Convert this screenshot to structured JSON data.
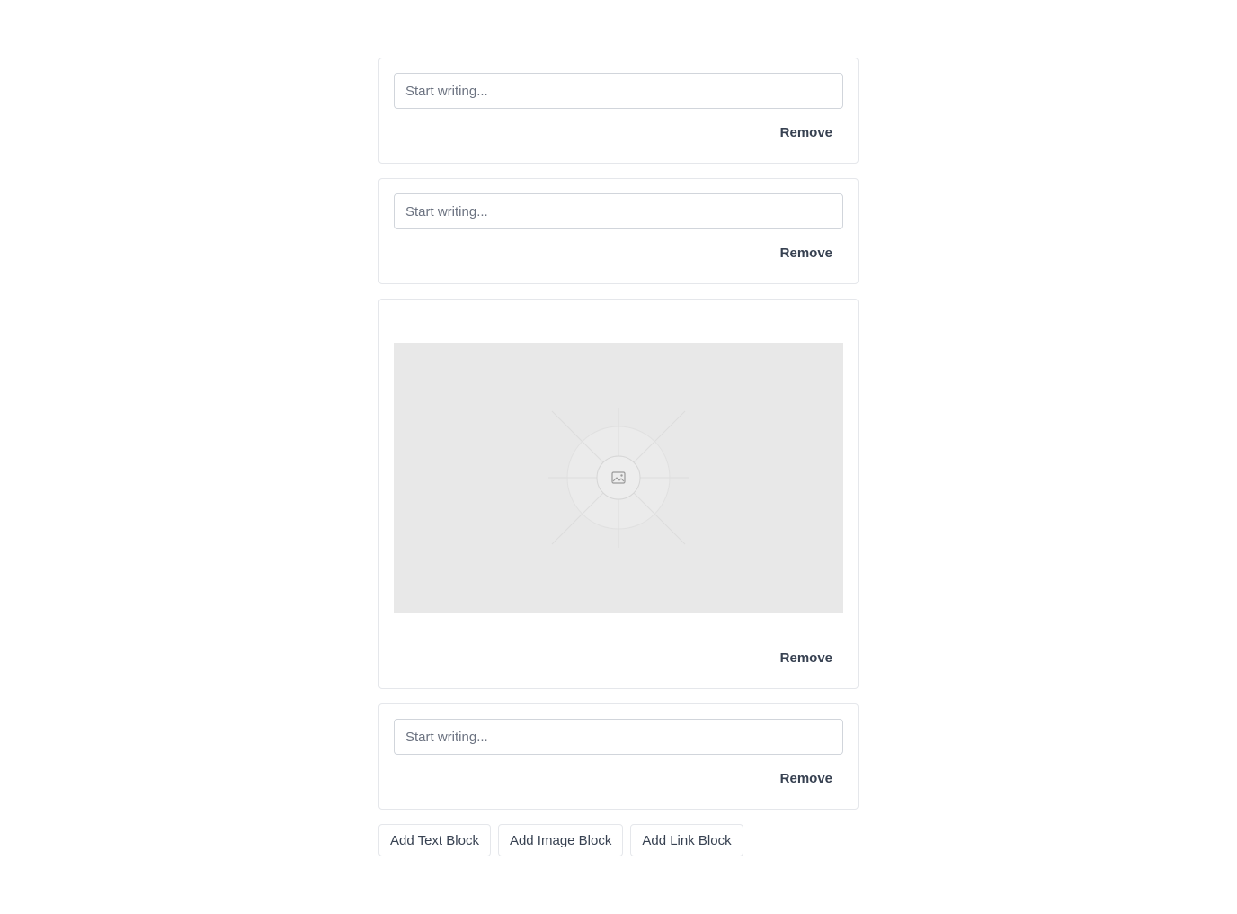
{
  "blocks": [
    {
      "type": "text",
      "placeholder": "Start writing...",
      "value": "",
      "remove_label": "Remove"
    },
    {
      "type": "text",
      "placeholder": "Start writing...",
      "value": "",
      "remove_label": "Remove"
    },
    {
      "type": "image",
      "icon": "image-icon",
      "remove_label": "Remove"
    },
    {
      "type": "text",
      "placeholder": "Start writing...",
      "value": "",
      "remove_label": "Remove"
    }
  ],
  "actions": {
    "add_text_label": "Add Text Block",
    "add_image_label": "Add Image Block",
    "add_link_label": "Add Link Block"
  },
  "colors": {
    "border": "#e5e7eb",
    "input_border": "#d1d5db",
    "text": "#374151",
    "placeholder_bg": "#e8e8e8"
  }
}
